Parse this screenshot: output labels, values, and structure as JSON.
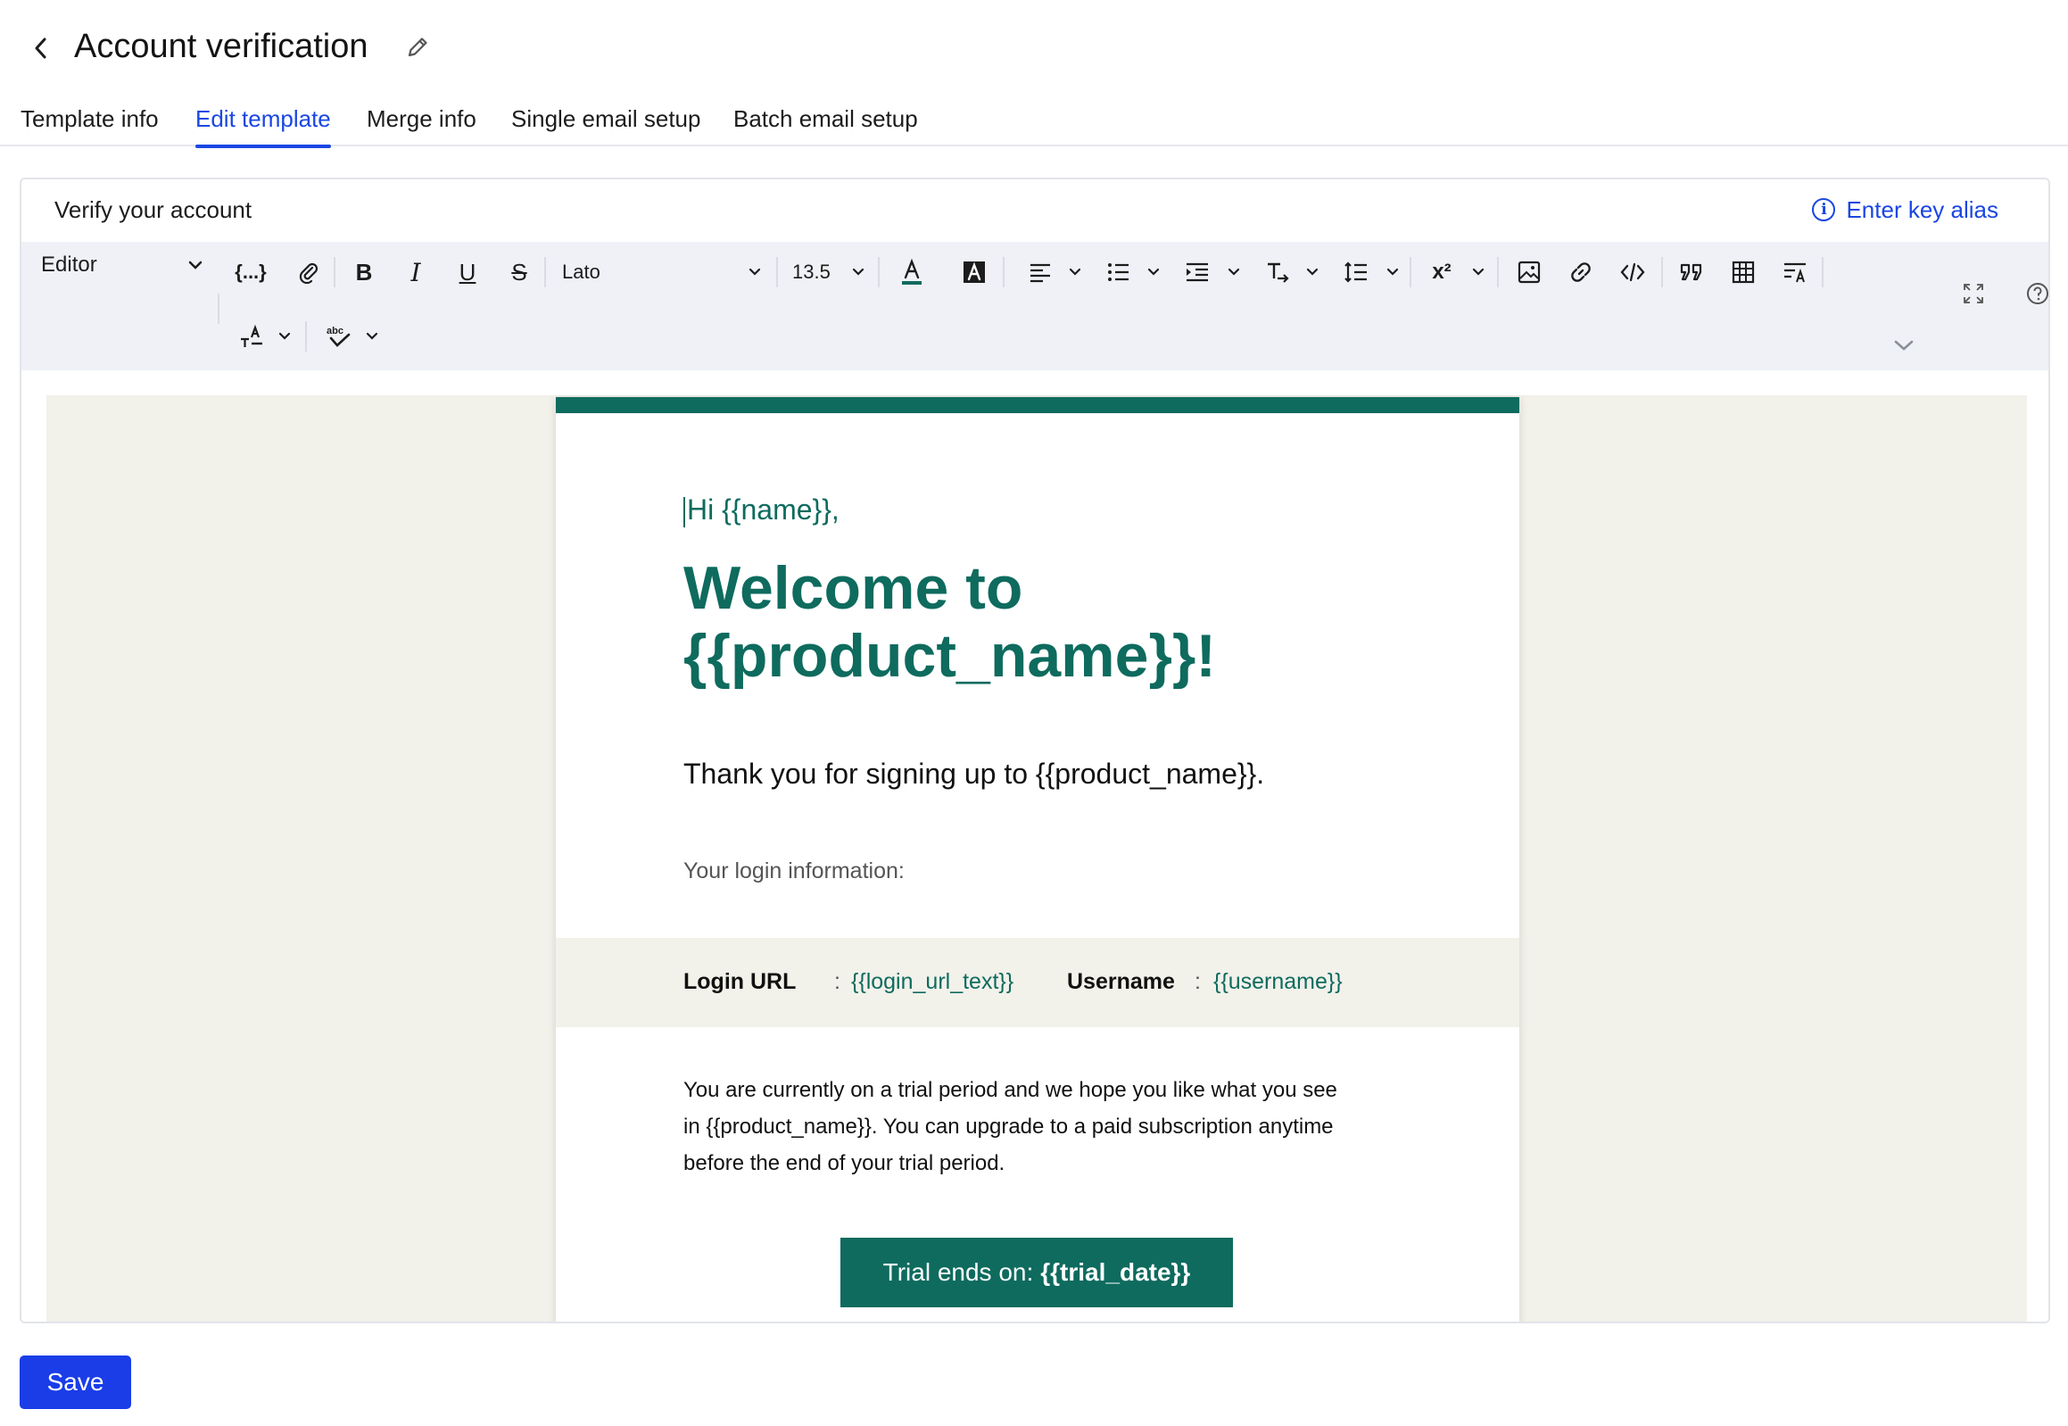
{
  "header": {
    "title": "Account verification"
  },
  "tabs": [
    {
      "label": "Template info"
    },
    {
      "label": "Edit template"
    },
    {
      "label": "Merge info"
    },
    {
      "label": "Single email setup"
    },
    {
      "label": "Batch email setup"
    }
  ],
  "active_tab": "Edit template",
  "editor": {
    "subject": "Verify your account",
    "key_alias_label": "Enter key alias",
    "toolbar": {
      "mode": "Editor",
      "merge_field_symbol": "{...}",
      "font": "Lato",
      "font_size": "13.5"
    }
  },
  "email": {
    "greeting": "Hi {{name}},",
    "headline_line1": "Welcome to",
    "headline_line2": "{{product_name}}!",
    "thanks": "Thank you for signing up to {{product_name}}.",
    "login_info": "Your login information:",
    "login_url_label": "Login URL",
    "login_url_value": "{{login_url_text}}",
    "username_label": "Username",
    "username_value": "{{username}}",
    "colon": ":",
    "trial_line1": "You are currently on a trial period and we hope you like what you see",
    "trial_line2": "in {{product_name}}. You can upgrade to a paid subscription anytime",
    "trial_line3": "before the end of your trial period.",
    "trial_button_prefix": "Trial ends on:",
    "trial_button_value": "{{trial_date}}"
  },
  "footer": {
    "save_label": "Save"
  },
  "colors": {
    "accent": "#1a46e3",
    "brand_green": "#0e6b5e",
    "canvas_bg": "#f2f1ea",
    "save_button": "#1a3de8"
  },
  "icons": {
    "back": "chevron-left-icon",
    "edit": "pencil-icon",
    "info": "info-icon"
  }
}
